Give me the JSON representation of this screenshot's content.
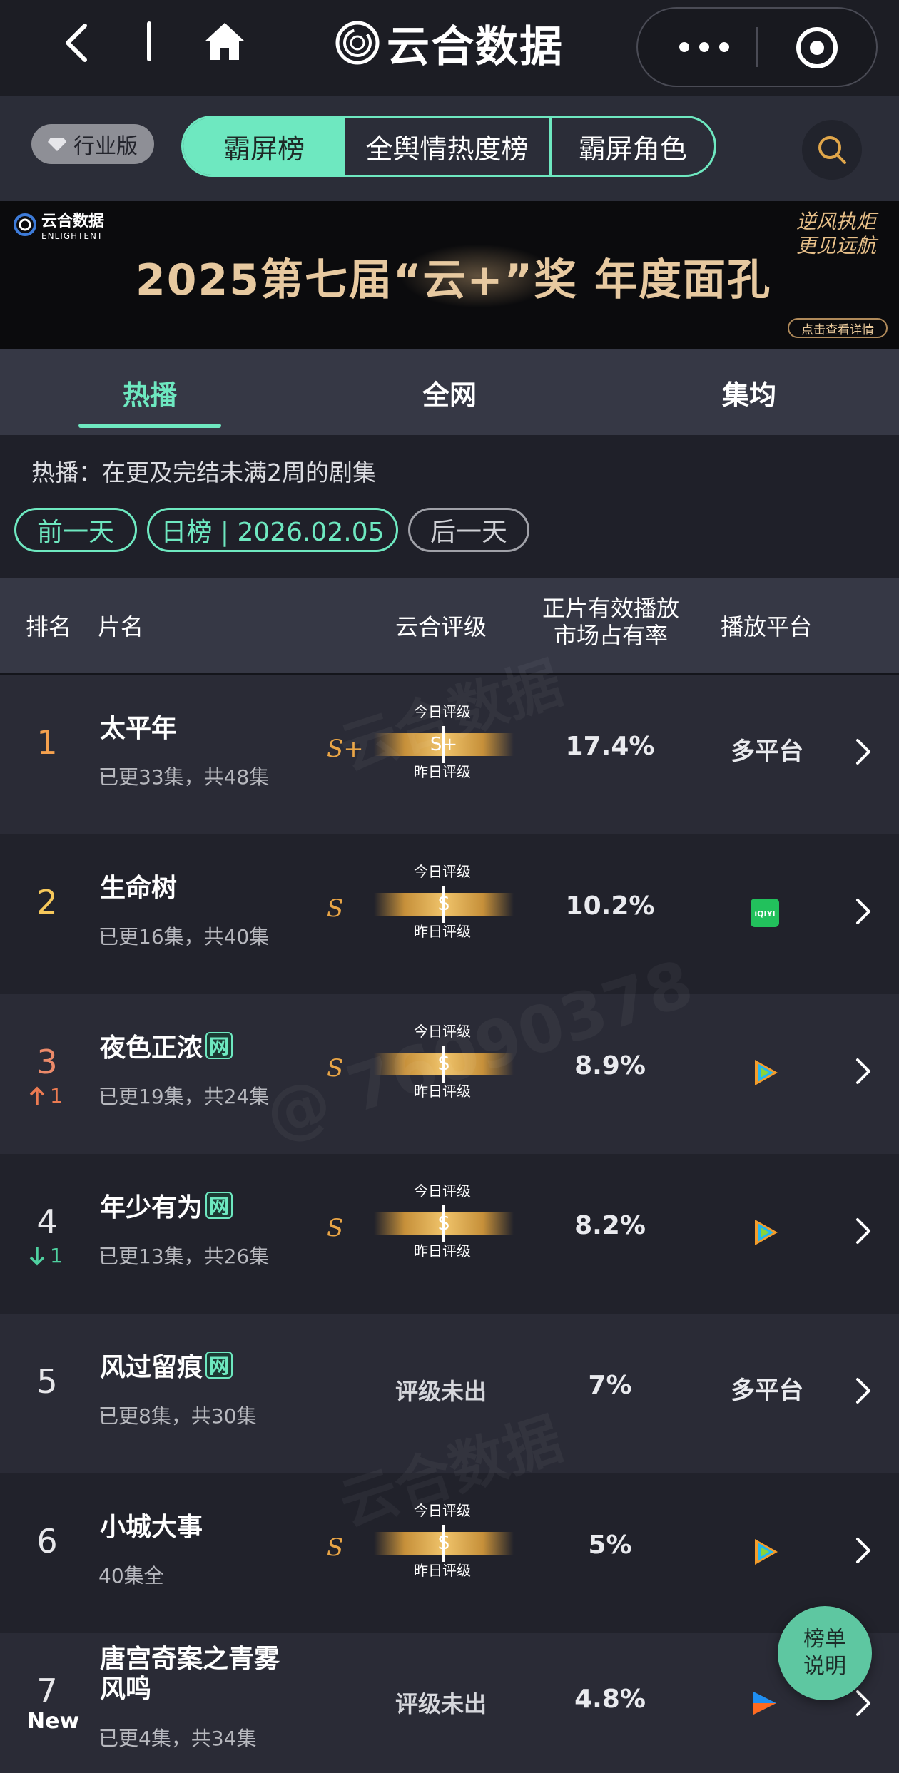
{
  "app": {
    "title": "云合数据",
    "icons": {
      "back": "chevron-left-icon",
      "home": "home-icon",
      "more": "more-dots-icon",
      "mini_program": "target-icon",
      "search": "search-icon"
    }
  },
  "filter": {
    "industry_label": "行业版",
    "segments": [
      "霸屏榜",
      "全舆情热度榜",
      "霸屏角色"
    ],
    "active_segment": "霸屏榜"
  },
  "banner": {
    "logo_cn": "云合数据",
    "logo_en": "ENLIGHTENT",
    "title": "2025第七届“云+”奖  年度面孔",
    "slogan": "逆风执炬 更见远航",
    "detail": "点击查看详情"
  },
  "tabs": {
    "items": [
      "热播",
      "全网",
      "集均"
    ],
    "active": "热播"
  },
  "description": "热播：在更及完结未满2周的剧集",
  "date_nav": {
    "prev": "前一天",
    "current": "日榜 | 2026.02.05",
    "next": "后一天"
  },
  "table": {
    "headers": {
      "rank": "排名",
      "name": "片名",
      "rating": "云合评级",
      "share": "正片有效播放市场占有率",
      "share_line1": "正片有效播放",
      "share_line2": "市场占有率",
      "platform": "播放平台"
    },
    "rating_today_label": "今日评级",
    "rating_yesterday_label": "昨日评级",
    "rows": [
      {
        "rank": "1",
        "trend": "",
        "name": "太平年",
        "net": "",
        "sub": "已更33集，共48集",
        "grade": "S+",
        "bar_grade": "S+",
        "share": "17.4%",
        "platform_text": "多平台",
        "platform_icon": ""
      },
      {
        "rank": "2",
        "trend": "",
        "name": "生命树",
        "net": "",
        "sub": "已更16集，共40集",
        "grade": "S",
        "bar_grade": "S",
        "share": "10.2%",
        "platform_text": "",
        "platform_icon": "iqiyi-icon"
      },
      {
        "rank": "3",
        "trend": "1",
        "name": "夜色正浓",
        "net": "网",
        "sub": "已更19集，共24集",
        "grade": "S",
        "bar_grade": "S",
        "share": "8.9%",
        "platform_text": "",
        "platform_icon": "tencent-video-icon"
      },
      {
        "rank": "4",
        "trend": "1",
        "name": "年少有为",
        "net": "网",
        "sub": "已更13集，共26集",
        "grade": "S",
        "bar_grade": "S",
        "share": "8.2%",
        "platform_text": "",
        "platform_icon": "tencent-video-icon"
      },
      {
        "rank": "5",
        "trend": "",
        "name": "风过留痕",
        "net": "网",
        "sub": "已更8集，共30集",
        "grade": "",
        "bar_grade": "",
        "no_grade": "评级未出",
        "share": "7%",
        "platform_text": "多平台",
        "platform_icon": ""
      },
      {
        "rank": "6",
        "trend": "",
        "name": "小城大事",
        "net": "",
        "sub": "40集全",
        "grade": "S",
        "bar_grade": "S",
        "share": "5%",
        "platform_text": "",
        "platform_icon": "tencent-video-icon"
      },
      {
        "rank": "7",
        "trend": "New",
        "name": "唐宫奇案之青雾风鸣",
        "name_line1": "唐宫奇案之青雾",
        "name_line2": "风鸣",
        "net": "",
        "sub": "已更4集，共34集",
        "grade": "",
        "bar_grade": "",
        "no_grade": "评级未出",
        "share": "4.8%",
        "platform_text": "",
        "platform_icon": "youku-icon"
      }
    ]
  },
  "fab": {
    "line1": "榜单",
    "line2": "说明"
  },
  "watermark": {
    "text": "云合数据",
    "en": "ENLIGHTENT",
    "handle": "@ 76090378"
  },
  "colors": {
    "accent": "#6ee8c0",
    "gold": "#e9a546",
    "up": "#ec7b52",
    "down": "#4fd0a0"
  }
}
